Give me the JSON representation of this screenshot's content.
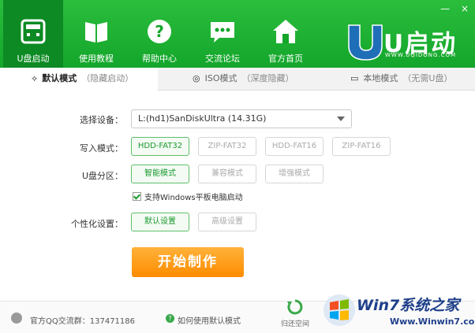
{
  "window": {
    "minimize": "—",
    "close": "×"
  },
  "nav": [
    {
      "label": "U盘启动",
      "icon": "usb-drive-icon",
      "active": true
    },
    {
      "label": "使用教程",
      "icon": "book-icon",
      "active": false
    },
    {
      "label": "帮助中心",
      "icon": "help-icon",
      "active": false
    },
    {
      "label": "交流论坛",
      "icon": "chat-bubble-icon",
      "active": false
    },
    {
      "label": "官方首页",
      "icon": "home-icon",
      "active": false
    }
  ],
  "brand": {
    "name": "U启动",
    "url": "WWW.UQIDONG.COM"
  },
  "tabs": [
    {
      "label": "默认模式",
      "hint": "（隐藏启动）",
      "icon": "share-icon"
    },
    {
      "label": "ISO模式",
      "hint": "（深度隐藏）",
      "icon": "disc-icon"
    },
    {
      "label": "本地模式",
      "hint": "（无需U盘）",
      "icon": "monitor-icon"
    }
  ],
  "form": {
    "device_label": "选择设备：",
    "device_value": "L:(hd1)SanDiskUltra (14.31G)",
    "write_label": "写入模式：",
    "write_options": [
      "HDD-FAT32",
      "ZIP-FAT32",
      "HDD-FAT16",
      "ZIP-FAT16"
    ],
    "partition_label": "U盘分区：",
    "partition_options": [
      "智能模式",
      "兼容模式",
      "增强模式"
    ],
    "checkbox_label": "支持Windows平板电脑启动",
    "personal_label": "个性化设置：",
    "personal_options": [
      "默认设置",
      "高级设置"
    ],
    "start_button": "开始制作"
  },
  "footer": {
    "qq_text": "官方QQ交流群：137471186",
    "help_text": "如何使用默认模式",
    "restore_text": "归还空间"
  },
  "watermark": {
    "title": "Win7系统之家",
    "url": "Www.Winwin7.com"
  },
  "colors": {
    "primary_green": "#13a62b",
    "accent_orange": "#ff8c00"
  }
}
